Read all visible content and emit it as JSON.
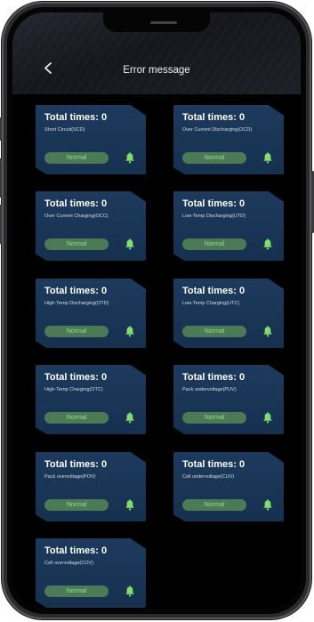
{
  "header": {
    "title": "Error message"
  },
  "icons": {
    "back": "chevron-left-icon",
    "alarm": "bell-icon"
  },
  "colors": {
    "accent_green": "#8fe08a",
    "card": "#1d3a5d",
    "status_pill": "#4c7a57"
  },
  "cards": [
    {
      "title": "Total times: 0",
      "desc": "Short Circuit(SCD)",
      "status": "Normal"
    },
    {
      "title": "Total times: 0",
      "desc": "Over Current Discharging(OCD)",
      "status": "Normal"
    },
    {
      "title": "Total times: 0",
      "desc": "Over Current Charging(OCC)",
      "status": "Normal"
    },
    {
      "title": "Total times: 0",
      "desc": "Low-Temp Discharging(UTD)",
      "status": "Normal"
    },
    {
      "title": "Total times: 0",
      "desc": "High-Temp Discharging(OTD)",
      "status": "Normal"
    },
    {
      "title": "Total times: 0",
      "desc": "Low-Temp Charging(UTC)",
      "status": "Normal"
    },
    {
      "title": "Total times: 0",
      "desc": "High-Temp Charging(OTC)",
      "status": "Normal"
    },
    {
      "title": "Total times: 0",
      "desc": "Pack undervoltage(PUV)",
      "status": "Normal"
    },
    {
      "title": "Total times: 0",
      "desc": "Pack overvoltage(POV)",
      "status": "Normal"
    },
    {
      "title": "Total times: 0",
      "desc": "Cell undervoltage(CUV)",
      "status": "Normal"
    },
    {
      "title": "Total times: 0",
      "desc": "Cell overvoltage(COV)",
      "status": "Normal"
    }
  ]
}
